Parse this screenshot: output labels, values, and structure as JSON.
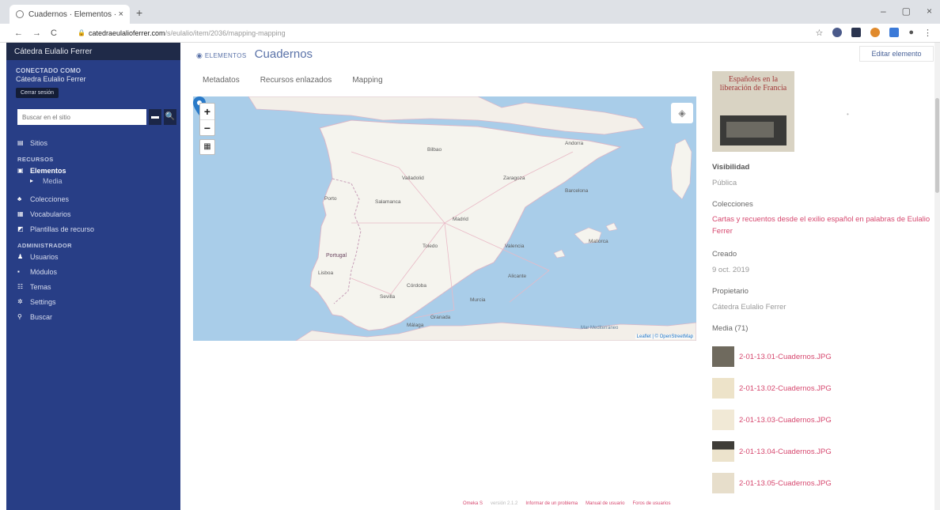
{
  "browser": {
    "tab_title": "Cuadernos · Elementos · Cated...",
    "tab_close": "×",
    "new_tab": "+",
    "window_controls": [
      "–",
      "▢",
      "×"
    ],
    "nav": {
      "back": "←",
      "forward": "→",
      "reload": "C"
    },
    "url_host": "catedraeulalioferrer.com",
    "url_path": "/s/eulalio/item/2036/mapping-mapping"
  },
  "sidebar": {
    "site_name": "Cátedra Eulalio Ferrer",
    "logged_in_label": "CONECTADO COMO",
    "user_name": "Cátedra Eulalio Ferrer",
    "logout_label": "Cerrar sesión",
    "search_placeholder": "Buscar en el sitio",
    "search_options_icon": "▬",
    "search_button_icon": "🔍",
    "sites_label": "Sitios",
    "resources_section": "RECURSOS",
    "items_label": "Elementos",
    "media_label": "Media",
    "collections_label": "Colecciones",
    "vocabularies_label": "Vocabularios",
    "templates_label": "Plantillas de recurso",
    "admin_section": "ADMINISTRADOR",
    "users_label": "Usuarios",
    "modules_label": "Módulos",
    "themes_label": "Temas",
    "settings_label": "Settings",
    "jobs_label": "Buscar"
  },
  "header": {
    "section_label": "ELEMENTOS",
    "title": "Cuadernos",
    "edit_button": "Editar elemento"
  },
  "tabs": [
    "Metadatos",
    "Recursos enlazados",
    "Mapping"
  ],
  "map": {
    "zoom_in": "+",
    "zoom_out": "−",
    "tool_icon": "▦",
    "layers_icon": "◈",
    "attribution": "Leaflet | © OpenStreetMap",
    "labels": {
      "madrid": "Madrid",
      "portugal": "Portugal",
      "sevilla": "Sevilla",
      "malaga": "Málaga",
      "valencia": "Valencia",
      "barcelona": "Barcelona",
      "zaragoza": "Zaragoza",
      "bilbao": "Bilbao",
      "mallorca": "Mallorca",
      "lisboa": "Lisboa",
      "porto": "Porto",
      "murcia": "Murcia",
      "granada": "Granada",
      "toledo": "Toledo",
      "salamanca": "Salamanca",
      "cordoba": "Córdoba",
      "valladolid": "Valladolid",
      "alicante": "Alicante",
      "andorra": "Andorra",
      "mar": "Mar Mediterráneo"
    }
  },
  "right_panel": {
    "cover_title": "Españoles en la liberación de Francia",
    "visibility_label": "Visibilidad",
    "visibility_value": "Pública",
    "collections_label": "Colecciones",
    "collection_link": "Cartas y recuentos desde el exilio español en palabras de Eulalio Ferrer",
    "created_label": "Creado",
    "created_value": "9 oct. 2019",
    "owner_label": "Propietario",
    "owner_value": "Cátedra Eulalio Ferrer",
    "media_label": "Media (71)",
    "media_items": [
      "2-01-13.01-Cuadernos.JPG",
      "2-01-13.02-Cuadernos.JPG",
      "2-01-13.03-Cuadernos.JPG",
      "2-01-13.04-Cuadernos.JPG",
      "2-01-13.05-Cuadernos.JPG"
    ]
  },
  "footer": [
    "Omeka S",
    "versión 2.1.2",
    "Informar de un problema",
    "Manual de usuario",
    "Foros de usuarios"
  ],
  "colors": {
    "sidebar": "#283e86",
    "accent": "#d6476e",
    "link_blue": "#5a72a8"
  }
}
